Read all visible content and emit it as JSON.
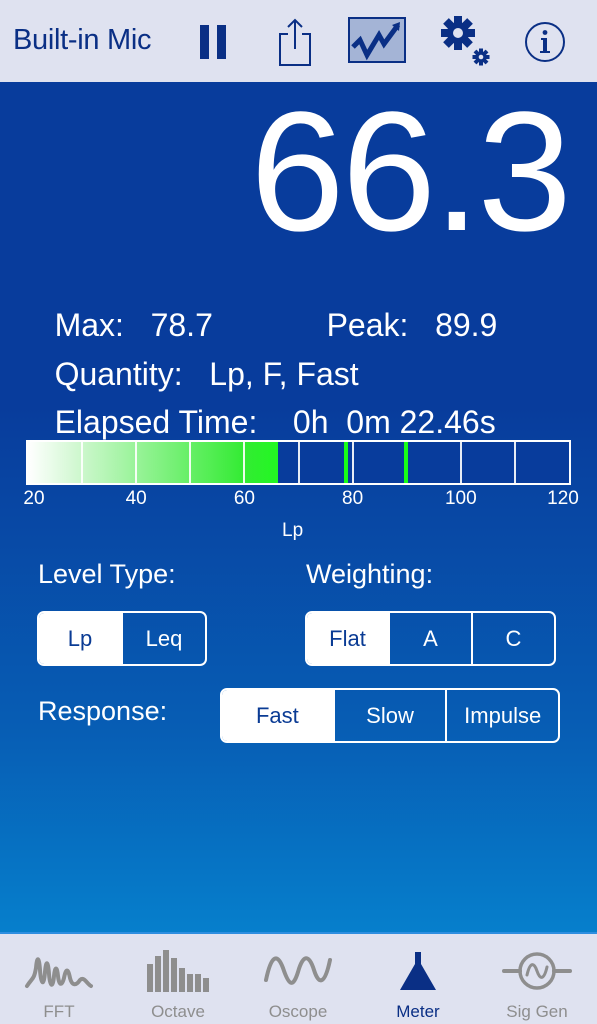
{
  "toolbar": {
    "input_source": "Built-in Mic",
    "icons": [
      "pause-icon",
      "share-icon",
      "graph-icon",
      "settings-icon",
      "info-icon"
    ],
    "graph_active": true
  },
  "reading": {
    "value": "66.3",
    "max_label": "Max:",
    "max_value": "78.7",
    "peak_label": "Peak:",
    "peak_value": "89.9",
    "quantity_label": "Quantity:",
    "quantity_value": "Lp, F, Fast",
    "elapsed_label": "Elapsed Time:",
    "elapsed_value": "0h  0m 22.46s"
  },
  "meter": {
    "min": 20,
    "max": 120,
    "level": 66.3,
    "max_marker": 78.7,
    "peak_marker": 89.9,
    "grid_step": 10,
    "tick_labels": [
      "20",
      "40",
      "60",
      "80",
      "100",
      "120"
    ],
    "unit_label": "Lp",
    "fill_color": "#18ff18",
    "background_color": "#083c9c"
  },
  "controls": {
    "level_type": {
      "label": "Level Type:",
      "options": [
        "Lp",
        "Leq"
      ],
      "selected": "Lp"
    },
    "weighting": {
      "label": "Weighting:",
      "options": [
        "Flat",
        "A",
        "C"
      ],
      "selected": "Flat"
    },
    "response": {
      "label": "Response:",
      "options": [
        "Fast",
        "Slow",
        "Impulse"
      ],
      "selected": "Fast"
    }
  },
  "tabs": [
    {
      "label": "FFT",
      "icon": "fft-icon",
      "active": false
    },
    {
      "label": "Octave",
      "icon": "octave-icon",
      "active": false
    },
    {
      "label": "Oscope",
      "icon": "oscope-icon",
      "active": false
    },
    {
      "label": "Meter",
      "icon": "meter-icon",
      "active": true
    },
    {
      "label": "Sig Gen",
      "icon": "sig-gen-icon",
      "active": false
    }
  ],
  "colors": {
    "accent": "#0a2f85",
    "bar_bg": "#dfe2f0",
    "inactive_tab": "#8e8e8e"
  }
}
